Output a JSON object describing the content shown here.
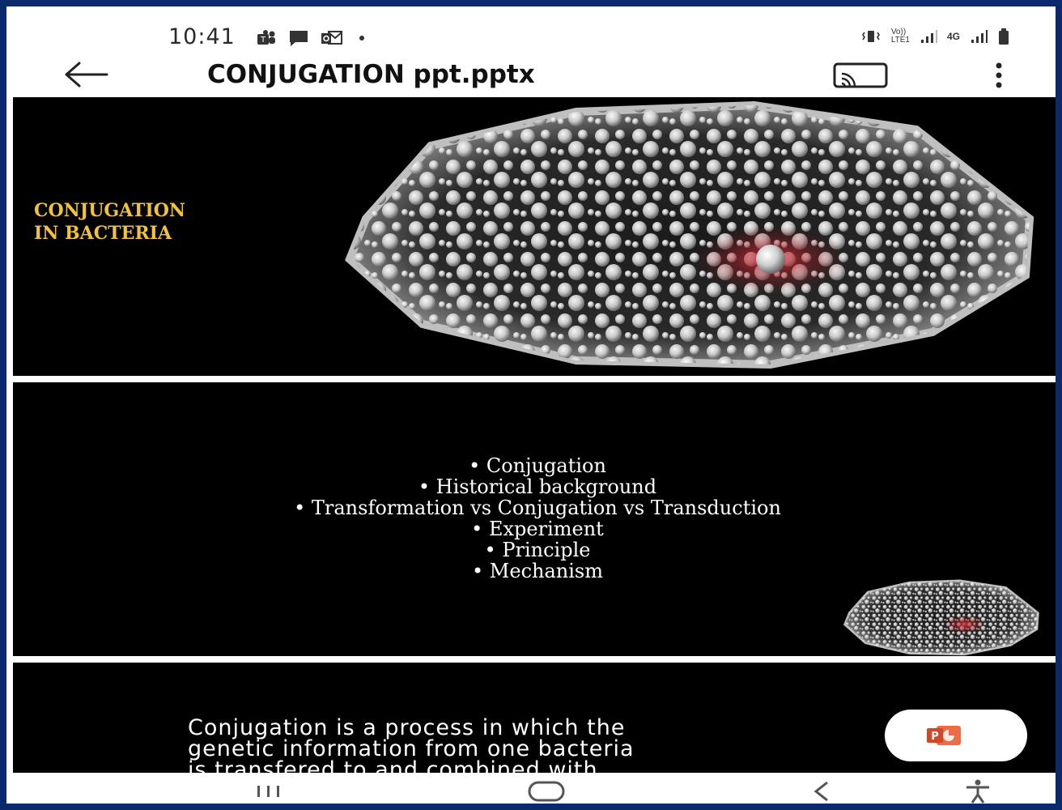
{
  "status_bar": {
    "time": "10:41",
    "notification_icons": [
      "teams-icon",
      "message-icon",
      "outlook-icon",
      "dot-icon"
    ],
    "system_icons": [
      "vibrate-icon",
      "volte-lte1-icon",
      "signal-icon",
      "4g-icon",
      "signal-icon",
      "battery-icon"
    ],
    "volte_text": "Vo))",
    "lte_text": "LTE1",
    "network_text": "4G"
  },
  "app_bar": {
    "title": "CONJUGATION ppt.pptx",
    "back_icon": "arrow-left-icon",
    "cast_icon": "cast-icon",
    "menu_icon": "more-vert-icon"
  },
  "slides": [
    {
      "title_lines": [
        "CONJUGATION",
        "IN BACTERIA"
      ],
      "image": "bacterium-illustration"
    },
    {
      "bullets": [
        "Conjugation",
        "Historical background",
        "Transformation vs Conjugation vs Transduction",
        "Experiment",
        "Principle",
        "Mechanism"
      ],
      "image": "bacterium-thumbnail"
    },
    {
      "text_lines": [
        "Conjugation is a process in which the",
        "genetic information from one bacteria",
        "is transfered to and combined with"
      ]
    }
  ],
  "fab": {
    "icon": "powerpoint-icon",
    "badge": "P"
  },
  "nav_bar": [
    "recents-icon",
    "home-icon",
    "back-icon",
    "accessibility-icon"
  ],
  "colors": {
    "frame_border": "#0b2a6e",
    "slide_background": "#000000",
    "title_gold": "#f2c33a",
    "cell_red": "#c0212a",
    "powerpoint_orange": "#d24726"
  }
}
